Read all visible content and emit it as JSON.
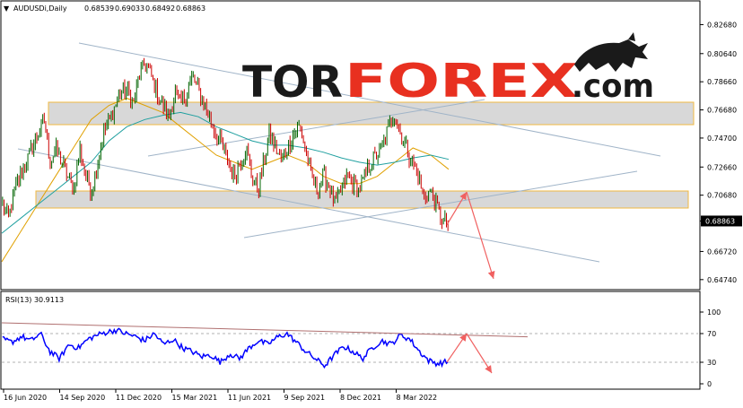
{
  "chart_data": {
    "type": "candlestick",
    "header": {
      "symbol": "AUDUSDi,Daily",
      "ohlc": [
        "0.68539",
        "0.69033",
        "0.68492",
        "0.68863"
      ]
    },
    "price_ticks": [
      "0.82680",
      "0.80640",
      "0.78660",
      "0.76680",
      "0.74700",
      "0.72660",
      "0.70680",
      "0.68863",
      "0.66720",
      "0.64740"
    ],
    "price_range": [
      0.6435,
      0.8315
    ],
    "current_price": 0.68863,
    "date_ticks": [
      "16 Jun 2020",
      "14 Sep 2020",
      "11 Dec 2020",
      "15 Mar 2021",
      "11 Jun 2021",
      "9 Sep 2021",
      "8 Dec 2021",
      "8 Mar 2022"
    ],
    "price_path": [
      0.7,
      0.69,
      0.71,
      0.72,
      0.73,
      0.74,
      0.75,
      0.76,
      0.73,
      0.74,
      0.73,
      0.72,
      0.71,
      0.74,
      0.72,
      0.71,
      0.73,
      0.75,
      0.76,
      0.77,
      0.78,
      0.78,
      0.77,
      0.79,
      0.8,
      0.79,
      0.78,
      0.77,
      0.76,
      0.78,
      0.77,
      0.78,
      0.79,
      0.78,
      0.77,
      0.76,
      0.75,
      0.74,
      0.73,
      0.72,
      0.73,
      0.74,
      0.72,
      0.71,
      0.73,
      0.75,
      0.74,
      0.73,
      0.74,
      0.75,
      0.755,
      0.74,
      0.72,
      0.71,
      0.72,
      0.715,
      0.7,
      0.71,
      0.72,
      0.715,
      0.71,
      0.72,
      0.73,
      0.735,
      0.74,
      0.755,
      0.765,
      0.75,
      0.74,
      0.73,
      0.72,
      0.705,
      0.71,
      0.7,
      0.69,
      0.685
    ],
    "moving_averages": [
      {
        "color": "#e0a000",
        "path": [
          0.66,
          0.68,
          0.7,
          0.72,
          0.74,
          0.76,
          0.77,
          0.775,
          0.77,
          0.765,
          0.755,
          0.745,
          0.735,
          0.73,
          0.725,
          0.73,
          0.735,
          0.73,
          0.72,
          0.715,
          0.715,
          0.72,
          0.73,
          0.74,
          0.735,
          0.725
        ]
      },
      {
        "color": "#20a0a0",
        "path": [
          0.68,
          0.69,
          0.7,
          0.71,
          0.72,
          0.73,
          0.745,
          0.755,
          0.76,
          0.763,
          0.765,
          0.762,
          0.755,
          0.75,
          0.745,
          0.742,
          0.742,
          0.74,
          0.737,
          0.733,
          0.73,
          0.728,
          0.73,
          0.733,
          0.735,
          0.732
        ]
      }
    ],
    "resistance_zone": [
      0.7595,
      0.7725
    ],
    "support_zone": [
      0.7045,
      0.7115
    ],
    "forecast": [
      0.686,
      0.709,
      0.648
    ],
    "rsi": {
      "label": "RSI(13) 30.9113",
      "ticks": [
        "100",
        "70",
        "30",
        "0"
      ],
      "levels": [
        70,
        30
      ],
      "path": [
        62,
        58,
        66,
        60,
        70,
        45,
        35,
        55,
        50,
        62,
        68,
        72,
        75,
        70,
        66,
        60,
        70,
        55,
        62,
        50,
        45,
        38,
        40,
        30,
        42,
        35,
        50,
        60,
        55,
        65,
        70,
        58,
        45,
        35,
        25,
        40,
        52,
        45,
        35,
        50,
        60,
        55,
        68,
        62,
        45,
        32,
        28,
        31
      ],
      "trendline": [
        80,
        68
      ],
      "forecast": [
        30,
        70,
        15
      ]
    },
    "series_colors": {
      "candle_up": "#006400",
      "candle_down": "#cc0000",
      "rsi_line": "#0000ff",
      "trendline": "#a0b4c8",
      "zone_fill": "#d8d8d8",
      "zone_border": "#f0b840",
      "forecast_arrow": "#f06060",
      "rsi_trendline": "#b07070"
    }
  },
  "watermark": {
    "part1": "TOR",
    "part2": "FOREX",
    "part3": ".com",
    "colors": {
      "tor": "#1a1a1a",
      "forex": "#e83020",
      "com": "#1a1a1a"
    }
  }
}
